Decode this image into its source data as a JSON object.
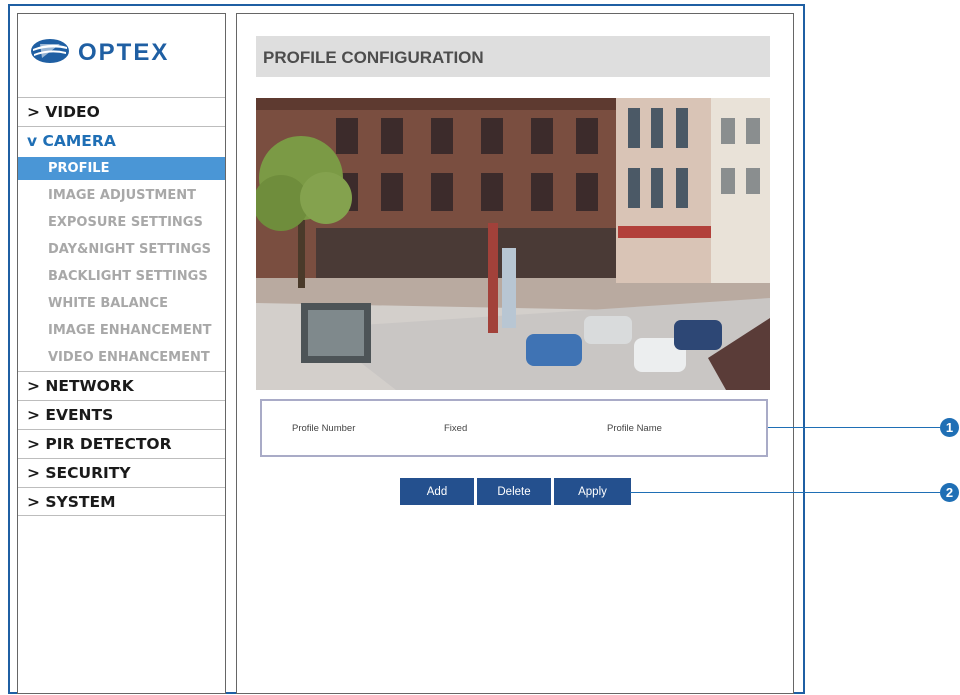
{
  "brand": {
    "logo_text": "OPTEX"
  },
  "sidebar": {
    "items": [
      {
        "label": "> VIDEO"
      },
      {
        "label": "v CAMERA",
        "subitems": [
          {
            "label": "PROFILE",
            "active": true
          },
          {
            "label": "IMAGE ADJUSTMENT"
          },
          {
            "label": "EXPOSURE SETTINGS"
          },
          {
            "label": "DAY&NIGHT SETTINGS"
          },
          {
            "label": "BACKLIGHT SETTINGS"
          },
          {
            "label": "WHITE BALANCE"
          },
          {
            "label": "IMAGE ENHANCEMENT"
          },
          {
            "label": "VIDEO ENHANCEMENT"
          }
        ]
      },
      {
        "label": "> NETWORK"
      },
      {
        "label": "> EVENTS"
      },
      {
        "label": "> PIR DETECTOR"
      },
      {
        "label": "> SECURITY"
      },
      {
        "label": "> SYSTEM"
      }
    ]
  },
  "main": {
    "title": "PROFILE CONFIGURATION",
    "camera_view": {
      "description_icon": "camera-live-view"
    },
    "profile_table": {
      "columns": [
        "Profile Number",
        "Fixed",
        "Profile Name"
      ]
    },
    "buttons": {
      "add": "Add",
      "delete": "Delete",
      "apply": "Apply"
    }
  },
  "callouts": [
    "1",
    "2"
  ],
  "colors": {
    "frame_blue": "#1f5fa3",
    "active_item": "#4a96d6",
    "button": "#24508e",
    "camera_label": "#1f6fb5"
  }
}
